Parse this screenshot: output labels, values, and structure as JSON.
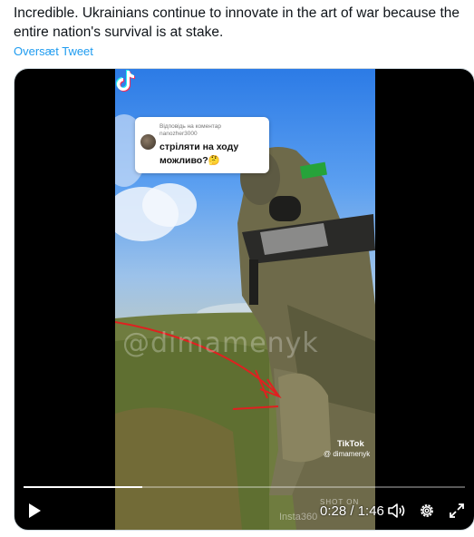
{
  "tweet": {
    "text_line1": "Incredible. Ukrainians continue to innovate in the art of war because the",
    "text_line2": "entire nation's survival is at stake.",
    "translate_link": "Oversæt Tweet"
  },
  "video": {
    "comment": {
      "header_line1": "Відповідь на коментар",
      "header_line2": "nanozher3000",
      "text": "стріляти на ходу можливо?🤔"
    },
    "watermark": "@dimamenyk",
    "tiktok_brand": "TikTok",
    "tiktok_user": "@ dimamenyk",
    "shot_on": "SHOT ON",
    "insta360": "Insta360",
    "progress_fraction": 0.27,
    "time_display": "0:28 / 1:46"
  },
  "colors": {
    "text": "#0f1419",
    "link": "#1d9bf0",
    "media_border": "#cfd9de",
    "annotation_red": "#e02020"
  },
  "icons": {
    "play": "play-icon",
    "volume": "volume-icon",
    "settings": "settings-icon",
    "fullscreen": "fullscreen-icon",
    "tiktok": "tiktok-icon"
  }
}
